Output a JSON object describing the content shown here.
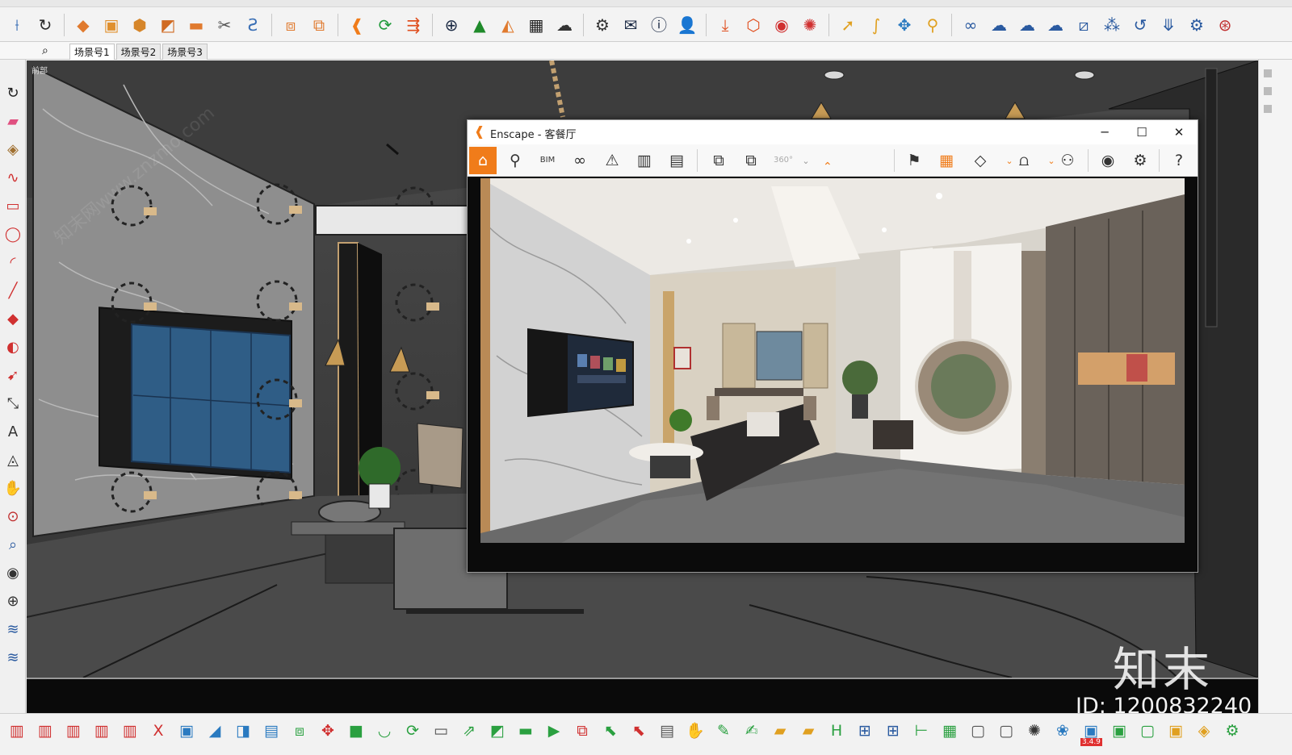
{
  "scene_tabs": [
    "场景号1",
    "场景号2",
    "场景号3"
  ],
  "viewport_label": "前部",
  "enscape": {
    "title": "Enscape - 客餐厅",
    "bim_label": "BIM",
    "vr_label": "360°"
  },
  "watermarks": {
    "brand": "知末",
    "id": "ID: 1200832240",
    "site": "知末网www.znzmo.com"
  },
  "bottom_badge": "3.4.9",
  "colors": {
    "accent": "#f07c1a",
    "tv_screen": "#2f5d86",
    "viewport_bg": "#454545"
  },
  "top_icons": [
    "select-icon",
    "orbit-icon",
    "eraser-icon",
    "paint-bucket-icon",
    "component-icon",
    "push-pull-icon",
    "move-icon",
    "tape-icon",
    "scale-icon",
    "enscape-logo-icon",
    "refresh-icon",
    "export-icon",
    "add-icon",
    "tree-icon",
    "terrain-icon",
    "checker-icon",
    "cloud-upload-icon",
    "gear-icon",
    "mail-icon",
    "info-icon",
    "user-icon",
    "import-icon",
    "section-icon",
    "ruby-icon",
    "settings-icon",
    "arrow-icon",
    "pen-icon",
    "move-cross-icon",
    "location-icon",
    "link-icon",
    "cloud-icon",
    "cloud-sync-icon",
    "cloud-list-icon",
    "window-icon",
    "grid-icon",
    "update-icon",
    "download-icon",
    "cog-icon",
    "help-icon"
  ],
  "left_icons": [
    "orbit-icon",
    "eraser-icon",
    "paint-icon",
    "freehand-icon",
    "rectangle-icon",
    "circle-icon",
    "arc-icon",
    "line-icon",
    "push-pull-icon",
    "rotate-icon",
    "follow-me-icon",
    "tape-icon",
    "text-icon",
    "protractor-icon",
    "pan-icon",
    "zoom-icon",
    "zoom-extents-icon",
    "walk-icon",
    "position-camera-icon",
    "section-icon",
    "section-fill-icon"
  ],
  "bottom_icons": [
    "window-icon",
    "window-2-icon",
    "window-3-icon",
    "window-4-icon",
    "window-5-icon",
    "axis-icon",
    "box-icon",
    "stairs-icon",
    "mirror-icon",
    "group-icon",
    "move-icon",
    "explode-icon",
    "face-icon",
    "arc-tool-icon",
    "cycle-icon",
    "trash-icon",
    "export-icon",
    "diagonal-icon",
    "bar-icon",
    "bar-plus-icon",
    "copy-icon",
    "cursor-icon",
    "cursor-2-icon",
    "list-icon",
    "hand-icon",
    "draw-icon",
    "pin-icon",
    "door-icon",
    "door-2-icon",
    "h-icon",
    "dim-icon",
    "dim-2-icon",
    "measure-icon",
    "layer-icon",
    "cube-icon",
    "cube-2-icon",
    "bug-icon",
    "flower-icon",
    "puzzle-icon",
    "box-green-icon",
    "cube-outline-icon",
    "cube-yellow-icon",
    "paint-can-icon",
    "gear-green-icon"
  ]
}
